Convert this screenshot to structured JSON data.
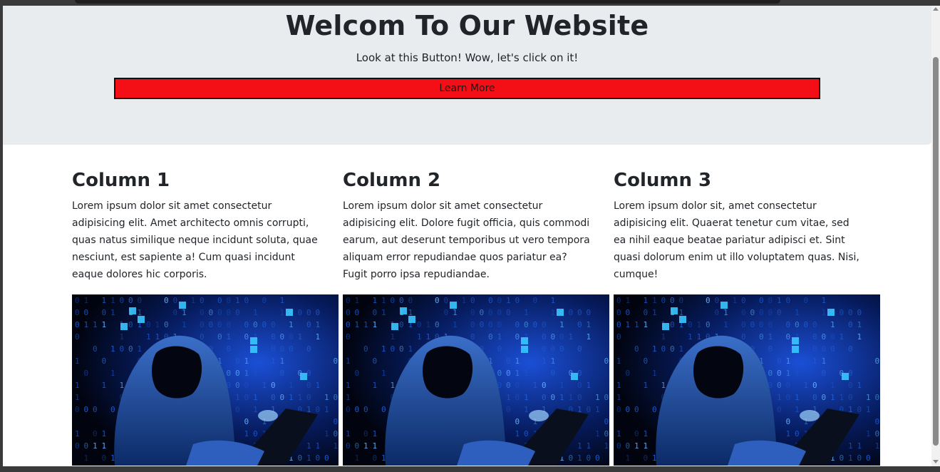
{
  "hero": {
    "title": "Welcom To Our Website",
    "subtitle": "Look at this Button! Wow, let's click on it!",
    "button_label": "Learn More",
    "button_color": "#f40f16",
    "background_color": "#e9ecef"
  },
  "columns": [
    {
      "title": "Column 1",
      "text": "Lorem ipsum dolor sit amet consectetur adipisicing elit. Amet architecto omnis corrupti, quas natus similique neque incidunt soluta, quae nesciunt, est sapiente a! Cum quasi incidunt eaque dolores hic corporis.",
      "image_icon": "hacker-image"
    },
    {
      "title": "Column 2",
      "text": "Lorem ipsum dolor sit amet consectetur adipisicing elit. Dolore fugit officia, quis commodi earum, aut deserunt temporibus ut vero tempora aliquam error repudiandae quos pariatur ea? Fugit porro ipsa repudiandae.",
      "image_icon": "hacker-image"
    },
    {
      "title": "Column 3",
      "text": "Lorem ipsum dolor sit, amet consectetur adipisicing elit. Quaerat tenetur cum vitae, sed ea nihil eaque beatae pariatur adipisci et. Sint quasi dolorum enim ut illo voluptatem quas. Nisi, cumque!",
      "image_icon": "hacker-image"
    }
  ]
}
